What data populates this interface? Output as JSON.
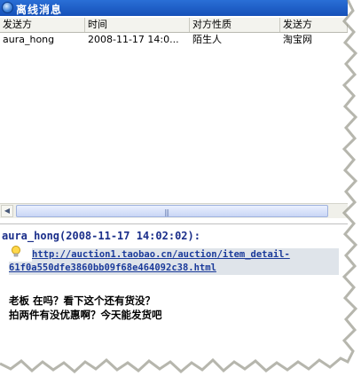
{
  "window": {
    "title": "离线消息"
  },
  "table": {
    "columns": [
      "发送方",
      "时间",
      "对方性质",
      "发送方"
    ],
    "rows": [
      {
        "sender": "aura_hong",
        "time": "2008-11-17 14:0...",
        "relation": "陌生人",
        "source": "淘宝网"
      }
    ]
  },
  "detail": {
    "header": "aura_hong(2008-11-17 14:02:02):",
    "link_line1": "http://auction1.taobao.cn/auction/item_detail-",
    "link_line2": "61f0a550dfe3860bb09f68e464092c38.html",
    "message_line1": "老板  在吗？看下这个还有货没？",
    "message_line2": "拍两件有没优惠啊？今天能发货吧"
  },
  "icons": {
    "app": "qq-app-icon",
    "bulb": "lightbulb-icon",
    "scroll_left": "arrow-left-icon",
    "scroll_right": "arrow-right-icon"
  },
  "colors": {
    "titlebar": "#1a5cc8",
    "link": "#1a3a9a",
    "header_text": "#1a2e8a"
  }
}
